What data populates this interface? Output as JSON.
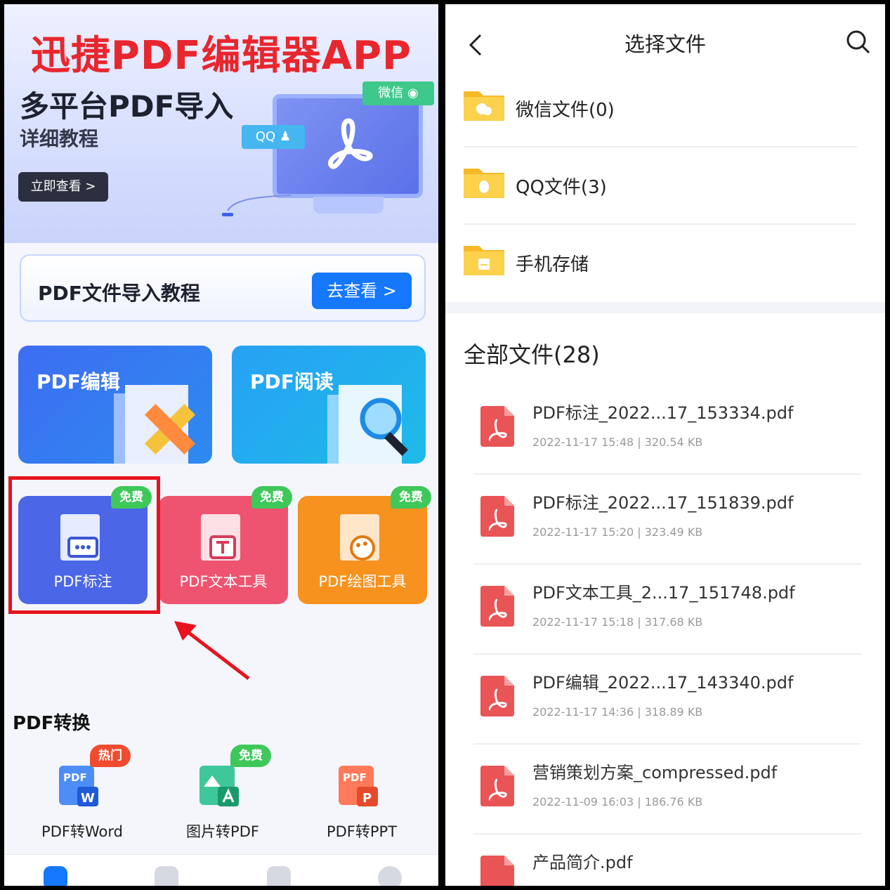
{
  "overlay_title": "迅捷PDF编辑器APP",
  "left": {
    "banner": {
      "title": "多平台PDF导入",
      "subtitle": "详细教程",
      "button": "立即查看 >",
      "bubble_qq": "QQ",
      "bubble_wechat": "微信"
    },
    "tutorial_card": {
      "text": "PDF文件导入教程",
      "button": "去查看 >"
    },
    "big_tiles": {
      "edit": "PDF编辑",
      "read": "PDF阅读"
    },
    "small_tiles": {
      "annotate": "PDF标注",
      "text_tool": "PDF文本工具",
      "draw_tool": "PDF绘图工具",
      "badge": "免费"
    },
    "conversion": {
      "title": "PDF转换",
      "word": "PDF转Word",
      "img": "图片转PDF",
      "ppt": "PDF转PPT",
      "hot_badge": "热门",
      "free_badge": "免费"
    }
  },
  "right": {
    "nav": {
      "title": "选择文件"
    },
    "folders": [
      "微信文件(0)",
      "QQ文件(3)",
      "手机存储"
    ],
    "all_files_title": "全部文件(28)",
    "files": [
      {
        "name": "PDF标注_2022...17_153334.pdf",
        "meta": "2022-11-17 15:48  |   320.54 KB"
      },
      {
        "name": "PDF标注_2022...17_151839.pdf",
        "meta": "2022-11-17 15:20  |   323.49 KB"
      },
      {
        "name": "PDF文本工具_2...17_151748.pdf",
        "meta": "2022-11-17 15:18  |   317.68 KB"
      },
      {
        "name": "PDF编辑_2022...17_143340.pdf",
        "meta": "2022-11-17 14:36  |   318.89 KB"
      },
      {
        "name": "营销策划方案_compressed.pdf",
        "meta": "2022-11-09 16:03  |   186.76 KB"
      },
      {
        "name": "产品简介.pdf",
        "meta": ""
      }
    ]
  },
  "colors": {
    "accent": "#1677ff",
    "highlight": "#e7141e",
    "overlay_title": "#e8262e"
  }
}
